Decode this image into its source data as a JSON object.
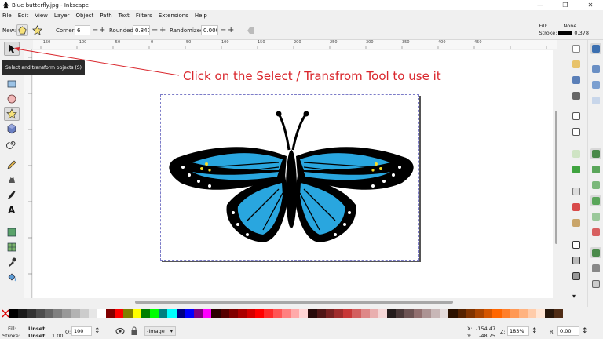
{
  "window": {
    "title": "Blue butterfly.jpg - Inkscape",
    "controls": [
      "—",
      "❐",
      "✕"
    ]
  },
  "menu": [
    "File",
    "Edit",
    "View",
    "Layer",
    "Object",
    "Path",
    "Text",
    "Filters",
    "Extensions",
    "Help"
  ],
  "tool_controls": {
    "new_label": "New:",
    "corners_label": "Corners:",
    "corners_value": "6",
    "rounded_label": "Rounded:",
    "rounded_value": "0.840",
    "randomized_label": "Randomized:",
    "randomized_value": "0.000",
    "minus": "−",
    "plus": "+"
  },
  "style_indicator": {
    "fill_label": "Fill:",
    "fill_value": "None",
    "stroke_label": "Stroke:",
    "stroke_value": "0.378"
  },
  "ruler_ticks": [
    "-150",
    "-100",
    "-50",
    "0",
    "50",
    "100",
    "150",
    "200",
    "250",
    "300",
    "350",
    "400",
    "450"
  ],
  "tooltip": "Select and transform objects (S)",
  "annotation": "Click on the Select / Transfrom Tool to use it",
  "colors": {
    "accent": "#d9262c",
    "butterfly_blue": "#29a6df",
    "palette": [
      "#000000",
      "#1a1a1a",
      "#333333",
      "#4d4d4d",
      "#666666",
      "#808080",
      "#999999",
      "#b3b3b3",
      "#cccccc",
      "#e6e6e6",
      "#ffffff",
      "#800000",
      "#ff0000",
      "#808000",
      "#ffff00",
      "#008000",
      "#00ff00",
      "#008080",
      "#00ffff",
      "#000080",
      "#0000ff",
      "#800080",
      "#ff00ff",
      "#2b0000",
      "#550000",
      "#800000",
      "#aa0000",
      "#d40000",
      "#ff0000",
      "#ff2a2a",
      "#ff5555",
      "#ff8080",
      "#ffaaaa",
      "#ffd5d5",
      "#280b0b",
      "#501616",
      "#782121",
      "#a02c2c",
      "#c83737",
      "#d35f5f",
      "#de8787",
      "#e9afaf",
      "#f4d7d7",
      "#241c1c",
      "#483737",
      "#6c5353",
      "#916f6f",
      "#ac9393",
      "#c8b7b7",
      "#e3dbdb",
      "#2b1100",
      "#552200",
      "#803300",
      "#aa4400",
      "#d45500",
      "#ff6600",
      "#ff7f2a",
      "#ff9955",
      "#ffb380",
      "#ffccaa",
      "#ffe6d5",
      "#28170b",
      "#502d16"
    ]
  },
  "status": {
    "fill_label": "Fill:",
    "fill_value": "Unset",
    "stroke_label": "Stroke:",
    "stroke_value": "Unset",
    "stroke_width": "1.00",
    "opacity_label": "O:",
    "opacity_value": "100",
    "layer_value": "-Image",
    "x_label": "X:",
    "x_value": "-154.47",
    "y_label": "Y:",
    "y_value": "-48.75",
    "zoom_label": "Z:",
    "zoom_value": "183%",
    "rotation_label": "R:",
    "rotation_value": "0.00"
  }
}
